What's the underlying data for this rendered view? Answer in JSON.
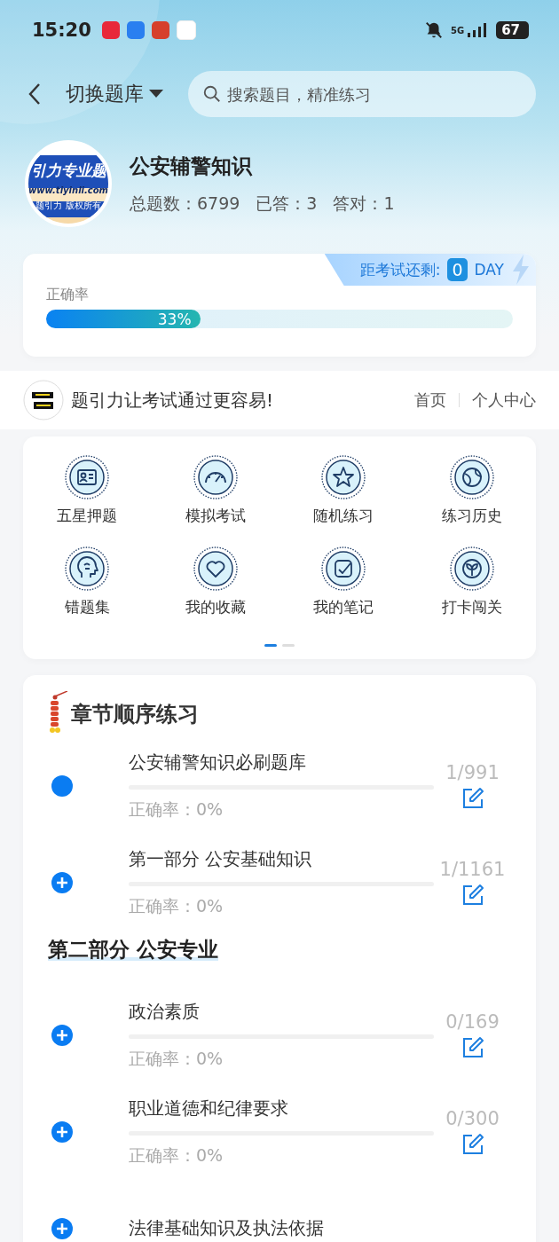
{
  "status_bar": {
    "time": "15:20",
    "network": "5G",
    "battery": "67"
  },
  "nav": {
    "title": "切换题库",
    "search": {
      "placeholder": "搜索题目，精准练习"
    }
  },
  "bank": {
    "logo_texts": [
      "引力专业题",
      "www.tiyinli.com",
      "题引力 版权所有"
    ],
    "name": "公安辅警知识",
    "stats": [
      {
        "label": "总题数：",
        "value": "6799"
      },
      {
        "label": "已答：",
        "value": "3"
      },
      {
        "label": "答对：",
        "value": "1"
      }
    ]
  },
  "accuracy": {
    "label": "正确率",
    "level": 0.33,
    "reading": "33%",
    "countdown": {
      "label": "距考试还剩:",
      "days": "0",
      "unit": "DAY"
    }
  },
  "slogan": {
    "text": "题引力让考试通过更容易!",
    "links": [
      "首页",
      "个人中心"
    ]
  },
  "features": [
    {
      "label": "五星押题"
    },
    {
      "label": "模拟考试"
    },
    {
      "label": "随机练习"
    },
    {
      "label": "练习历史"
    },
    {
      "label": "错题集"
    },
    {
      "label": "我的收藏"
    },
    {
      "label": "我的笔记"
    },
    {
      "label": "打卡闯关"
    }
  ],
  "pager": [
    {
      "selected": true
    },
    {
      "selected": false
    }
  ],
  "chapters": {
    "title": "章节顺序练习",
    "items": [
      {
        "kind": "topic",
        "title": "公安辅警知识必刷题库",
        "accuracy": "正确率：0%",
        "count": "1/991"
      },
      {
        "kind": "group",
        "title": "第一部分 公安基础知识",
        "accuracy": "正确率：0%",
        "count": "1/1161"
      },
      {
        "kind": "section",
        "title": "第二部分 公安专业"
      },
      {
        "kind": "group",
        "title": "政治素质",
        "accuracy": "正确率：0%",
        "count": "0/169"
      },
      {
        "kind": "group",
        "title": "职业道德和纪律要求",
        "accuracy": "正确率：0%",
        "count": "0/300"
      },
      {
        "kind": "group",
        "title": "法律基础知识及执法依据"
      }
    ]
  }
}
